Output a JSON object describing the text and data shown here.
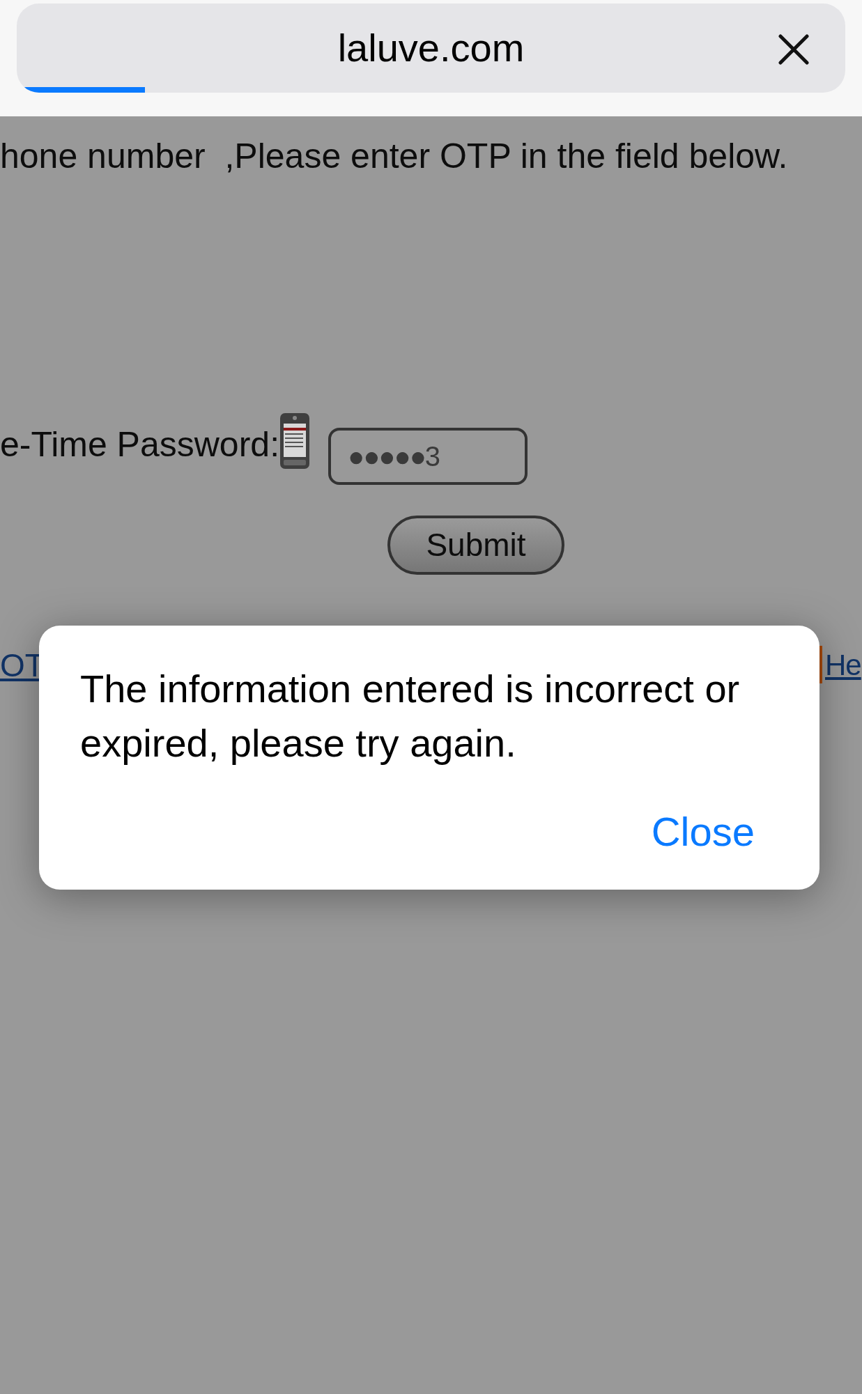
{
  "browser_bar": {
    "address": "laluve.com",
    "progress": {
      "level": 0.15
    }
  },
  "page": {
    "instruction": "hone number  ,Please enter OTP in the field below.",
    "password_label": "e-Time Password:",
    "password_field": {
      "value": "●●●●●3"
    },
    "submit_button": "Submit",
    "links": [
      {
        "kind": "left",
        "label": "OT"
      },
      {
        "kind": "right",
        "label": "He"
      }
    ]
  },
  "dialog": {
    "message": "The information entered is incorrect or expired, please try again.",
    "button": "Close"
  }
}
